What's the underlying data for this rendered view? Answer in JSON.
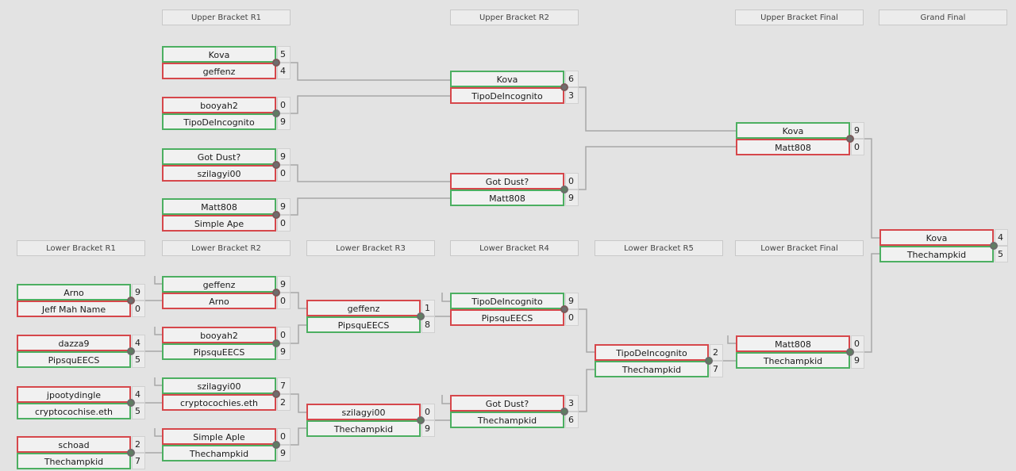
{
  "colors": {
    "winner": "#4caf61",
    "loser": "#d6474b",
    "background": "#e3e3e3",
    "connector": "#a8a8a8"
  },
  "rounds": {
    "ub_r1": "Upper Bracket R1",
    "ub_r2": "Upper Bracket R2",
    "ub_final": "Upper Bracket Final",
    "grand_final": "Grand Final",
    "lb_r1": "Lower Bracket R1",
    "lb_r2": "Lower Bracket R2",
    "lb_r3": "Lower Bracket R3",
    "lb_r4": "Lower Bracket R4",
    "lb_r5": "Lower Bracket R5",
    "lb_final": "Lower Bracket Final"
  },
  "matches": [
    {
      "id": "ub1m1",
      "round": "ub_r1",
      "top": {
        "name": "Kova",
        "score": "5",
        "result": "win"
      },
      "bottom": {
        "name": "geffenz",
        "score": "4",
        "result": "lose"
      }
    },
    {
      "id": "ub1m2",
      "round": "ub_r1",
      "top": {
        "name": "booyah2",
        "score": "0",
        "result": "lose"
      },
      "bottom": {
        "name": "TipoDeIncognito",
        "score": "9",
        "result": "win"
      }
    },
    {
      "id": "ub1m3",
      "round": "ub_r1",
      "top": {
        "name": "Got Dust?",
        "score": "9",
        "result": "win"
      },
      "bottom": {
        "name": "szilagyi00",
        "score": "0",
        "result": "lose"
      }
    },
    {
      "id": "ub1m4",
      "round": "ub_r1",
      "top": {
        "name": "Matt808",
        "score": "9",
        "result": "win"
      },
      "bottom": {
        "name": "Simple Ape",
        "score": "0",
        "result": "lose"
      }
    },
    {
      "id": "ub2m1",
      "round": "ub_r2",
      "top": {
        "name": "Kova",
        "score": "6",
        "result": "win"
      },
      "bottom": {
        "name": "TipoDeIncognito",
        "score": "3",
        "result": "lose"
      }
    },
    {
      "id": "ub2m2",
      "round": "ub_r2",
      "top": {
        "name": "Got Dust?",
        "score": "0",
        "result": "lose"
      },
      "bottom": {
        "name": "Matt808",
        "score": "9",
        "result": "win"
      }
    },
    {
      "id": "ubf",
      "round": "ub_final",
      "top": {
        "name": "Kova",
        "score": "9",
        "result": "win"
      },
      "bottom": {
        "name": "Matt808",
        "score": "0",
        "result": "lose"
      }
    },
    {
      "id": "gf",
      "round": "grand_final",
      "top": {
        "name": "Kova",
        "score": "4",
        "result": "lose"
      },
      "bottom": {
        "name": "Thechampkid",
        "score": "5",
        "result": "win"
      }
    },
    {
      "id": "lb1m1",
      "round": "lb_r1",
      "top": {
        "name": "Arno",
        "score": "9",
        "result": "win"
      },
      "bottom": {
        "name": "Jeff Mah Name",
        "score": "0",
        "result": "lose"
      }
    },
    {
      "id": "lb1m2",
      "round": "lb_r1",
      "top": {
        "name": "dazza9",
        "score": "4",
        "result": "lose"
      },
      "bottom": {
        "name": "PipsquEECS",
        "score": "5",
        "result": "win"
      }
    },
    {
      "id": "lb1m3",
      "round": "lb_r1",
      "top": {
        "name": "jpootydingle",
        "score": "4",
        "result": "lose"
      },
      "bottom": {
        "name": "cryptocochise.eth",
        "score": "5",
        "result": "win"
      }
    },
    {
      "id": "lb1m4",
      "round": "lb_r1",
      "top": {
        "name": "schoad",
        "score": "2",
        "result": "lose"
      },
      "bottom": {
        "name": "Thechampkid",
        "score": "7",
        "result": "win"
      }
    },
    {
      "id": "lb2m1",
      "round": "lb_r2",
      "top": {
        "name": "geffenz",
        "score": "9",
        "result": "win"
      },
      "bottom": {
        "name": "Arno",
        "score": "0",
        "result": "lose"
      }
    },
    {
      "id": "lb2m2",
      "round": "lb_r2",
      "top": {
        "name": "booyah2",
        "score": "0",
        "result": "lose"
      },
      "bottom": {
        "name": "PipsquEECS",
        "score": "9",
        "result": "win"
      }
    },
    {
      "id": "lb2m3",
      "round": "lb_r2",
      "top": {
        "name": "szilagyi00",
        "score": "7",
        "result": "win"
      },
      "bottom": {
        "name": "cryptocochies.eth",
        "score": "2",
        "result": "lose"
      }
    },
    {
      "id": "lb2m4",
      "round": "lb_r2",
      "top": {
        "name": "Simple Aple",
        "score": "0",
        "result": "lose"
      },
      "bottom": {
        "name": "Thechampkid",
        "score": "9",
        "result": "win"
      }
    },
    {
      "id": "lb3m1",
      "round": "lb_r3",
      "top": {
        "name": "geffenz",
        "score": "1",
        "result": "lose"
      },
      "bottom": {
        "name": "PipsquEECS",
        "score": "8",
        "result": "win"
      }
    },
    {
      "id": "lb3m2",
      "round": "lb_r3",
      "top": {
        "name": "szilagyi00",
        "score": "0",
        "result": "lose"
      },
      "bottom": {
        "name": "Thechampkid",
        "score": "9",
        "result": "win"
      }
    },
    {
      "id": "lb4m1",
      "round": "lb_r4",
      "top": {
        "name": "TipoDeIncognito",
        "score": "9",
        "result": "win"
      },
      "bottom": {
        "name": "PipsquEECS",
        "score": "0",
        "result": "lose"
      }
    },
    {
      "id": "lb4m2",
      "round": "lb_r4",
      "top": {
        "name": "Got Dust?",
        "score": "3",
        "result": "lose"
      },
      "bottom": {
        "name": "Thechampkid",
        "score": "6",
        "result": "win"
      }
    },
    {
      "id": "lb5m1",
      "round": "lb_r5",
      "top": {
        "name": "TipoDeIncognito",
        "score": "2",
        "result": "lose"
      },
      "bottom": {
        "name": "Thechampkid",
        "score": "7",
        "result": "win"
      }
    },
    {
      "id": "lbf",
      "round": "lb_final",
      "top": {
        "name": "Matt808",
        "score": "0",
        "result": "lose"
      },
      "bottom": {
        "name": "Thechampkid",
        "score": "9",
        "result": "win"
      }
    }
  ]
}
